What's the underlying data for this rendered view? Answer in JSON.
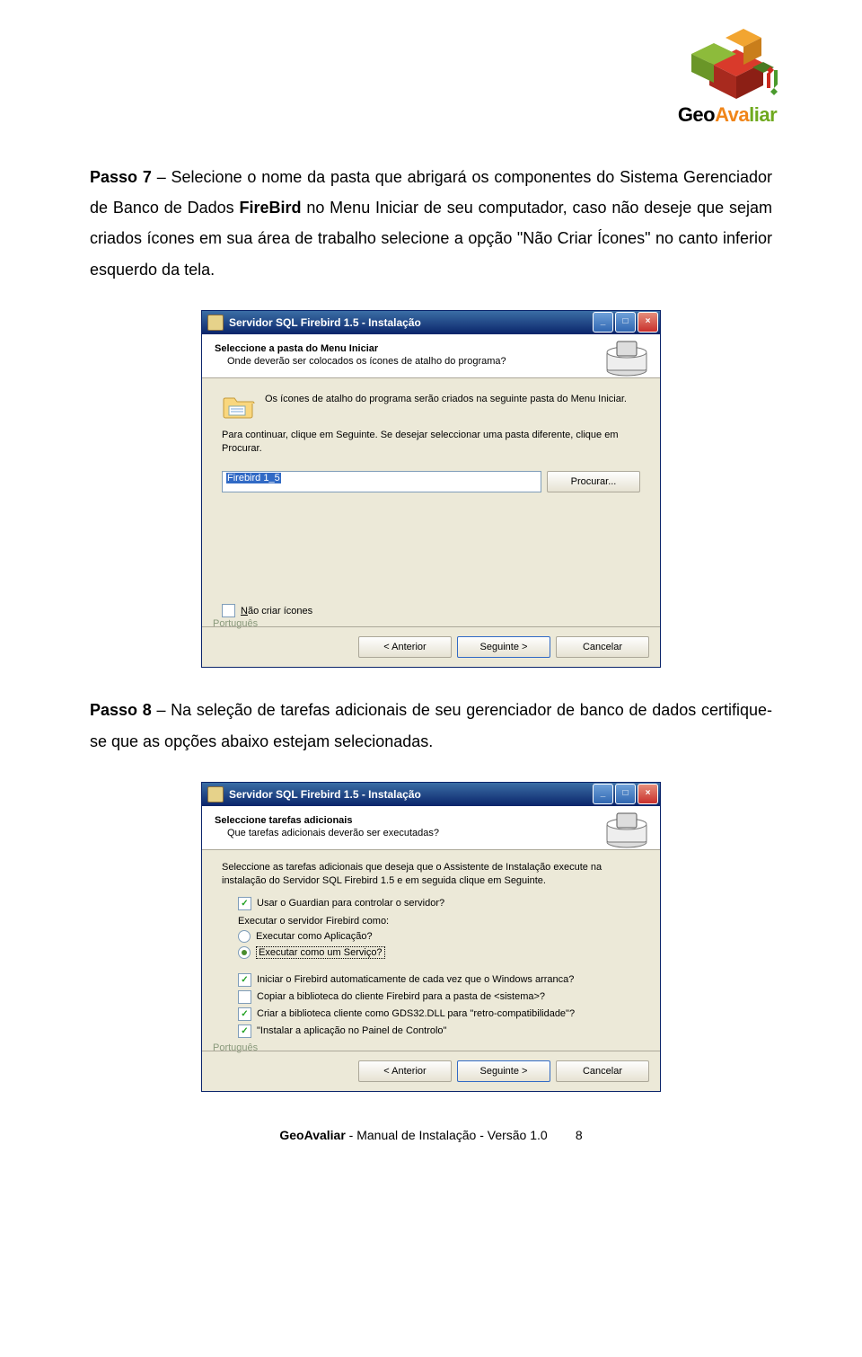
{
  "logo": {
    "geo": "Geo",
    "ava": "Ava",
    "liar": "liar"
  },
  "para1": {
    "prefix": "Passo 7",
    "t1": " – Selecione o nome da pasta que abrigará os componentes do Sistema Gerenciador de Banco de Dados ",
    "bold1": "FireBird",
    "t2": " no Menu Iniciar de seu computador, caso não deseje que sejam criados ícones em sua área de trabalho selecione a opção \"Não Criar Ícones\" no canto inferior esquerdo da tela."
  },
  "win1": {
    "title": "Servidor SQL Firebird 1.5 - Instalação",
    "head1": "Seleccione a pasta do Menu Iniciar",
    "head2": "Onde deverão ser colocados os ícones de atalho do programa?",
    "line1": "Os ícones de atalho do programa serão criados na seguinte pasta do Menu Iniciar.",
    "line2": "Para continuar, clique em Seguinte. Se desejar seleccionar uma pasta diferente, clique em Procurar.",
    "input_value": "Firebird 1_5",
    "browse": "Procurar...",
    "no_icons": "Não criar ícones",
    "lang": "Português",
    "back": "< Anterior",
    "next": "Seguinte >",
    "cancel": "Cancelar"
  },
  "para2": {
    "prefix": "Passo 8",
    "text": " – Na seleção de tarefas adicionais de seu gerenciador de banco de dados certifique-se que as opções abaixo estejam selecionadas."
  },
  "win2": {
    "title": "Servidor SQL Firebird 1.5 - Instalação",
    "head1": "Seleccione tarefas adicionais",
    "head2": "Que tarefas adicionais deverão ser executadas?",
    "intro": "Seleccione as tarefas adicionais que deseja que o Assistente de Instalação execute na instalação do Servidor SQL Firebird 1.5 e em seguida clique em Seguinte.",
    "opt_guardian": "Usar o Guardian para controlar o servidor?",
    "heading_exec": "Executar o servidor Firebird como:",
    "opt_app": "Executar como Aplicação?",
    "opt_service": "Executar como um Serviço?",
    "opt_autostart": "Iniciar o Firebird automaticamente de cada vez que o Windows arranca?",
    "opt_copy": "Copiar a biblioteca do cliente Firebird para a pasta de <sistema>?",
    "opt_gds": "Criar a biblioteca cliente como GDS32.DLL para \"retro-compatibilidade\"?",
    "opt_panel": "\"Instalar a aplicação no Painel de Controlo\"",
    "lang": "Português",
    "back": "< Anterior",
    "next": "Seguinte >",
    "cancel": "Cancelar"
  },
  "footer": {
    "bold": "GeoAvaliar",
    "rest": " - Manual de Instalação - Versão 1.0",
    "page": "8"
  }
}
